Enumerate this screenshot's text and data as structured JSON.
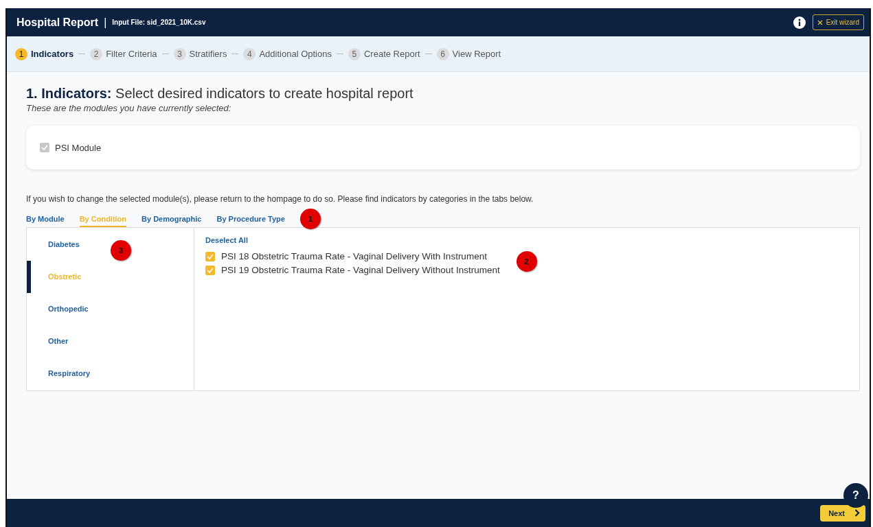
{
  "header": {
    "title": "Hospital Report",
    "separator": "|",
    "file_label": "Input File: sid_2021_10K.csv",
    "exit_button": "Exit wizard"
  },
  "steps": [
    {
      "number": "1",
      "label": "Indicators",
      "selected": true
    },
    {
      "number": "2",
      "label": "Filter Criteria",
      "selected": false
    },
    {
      "number": "3",
      "label": "Stratifiers",
      "selected": false
    },
    {
      "number": "4",
      "label": "Additional Options",
      "selected": false
    },
    {
      "number": "5",
      "label": "Create Report",
      "selected": false
    },
    {
      "number": "6",
      "label": "View Report",
      "selected": false
    }
  ],
  "heading": "**1. Indicators:** Select desired indicators to create hospital report",
  "subtitle": "These are the modules you have currently selected:",
  "modules": [
    {
      "label": "PSI Module",
      "checked": true,
      "disabled": true
    }
  ],
  "info_text": "If you wish to change the selected module(s), please return to the hompage to do so. Please find indicators by categories in the tabs below.",
  "tabs": [
    {
      "label": "By Module",
      "selected": false
    },
    {
      "label": "By Condition",
      "selected": true
    },
    {
      "label": "By Demographic",
      "selected": false
    },
    {
      "label": "By Procedure Type",
      "selected": false
    }
  ],
  "tabs_callout": "1",
  "categories": [
    {
      "label": "Diabetes",
      "selected": false
    },
    {
      "label": "Obstretic",
      "selected": true
    },
    {
      "label": "Orthopedic",
      "selected": false
    },
    {
      "label": "Other",
      "selected": false
    },
    {
      "label": "Respiratory",
      "selected": false
    }
  ],
  "categories_callout": "3",
  "deselect_all": "Deselect All",
  "indicators": [
    {
      "label": "PSI 18 Obstetric Trauma Rate - Vaginal Delivery With Instrument",
      "checked": true
    },
    {
      "label": "PSI 19 Obstetric Trauma Rate - Vaginal Delivery Without Instrument",
      "checked": true
    }
  ],
  "indicators_callout": "2",
  "help_button": "?",
  "next_button": "Next"
}
